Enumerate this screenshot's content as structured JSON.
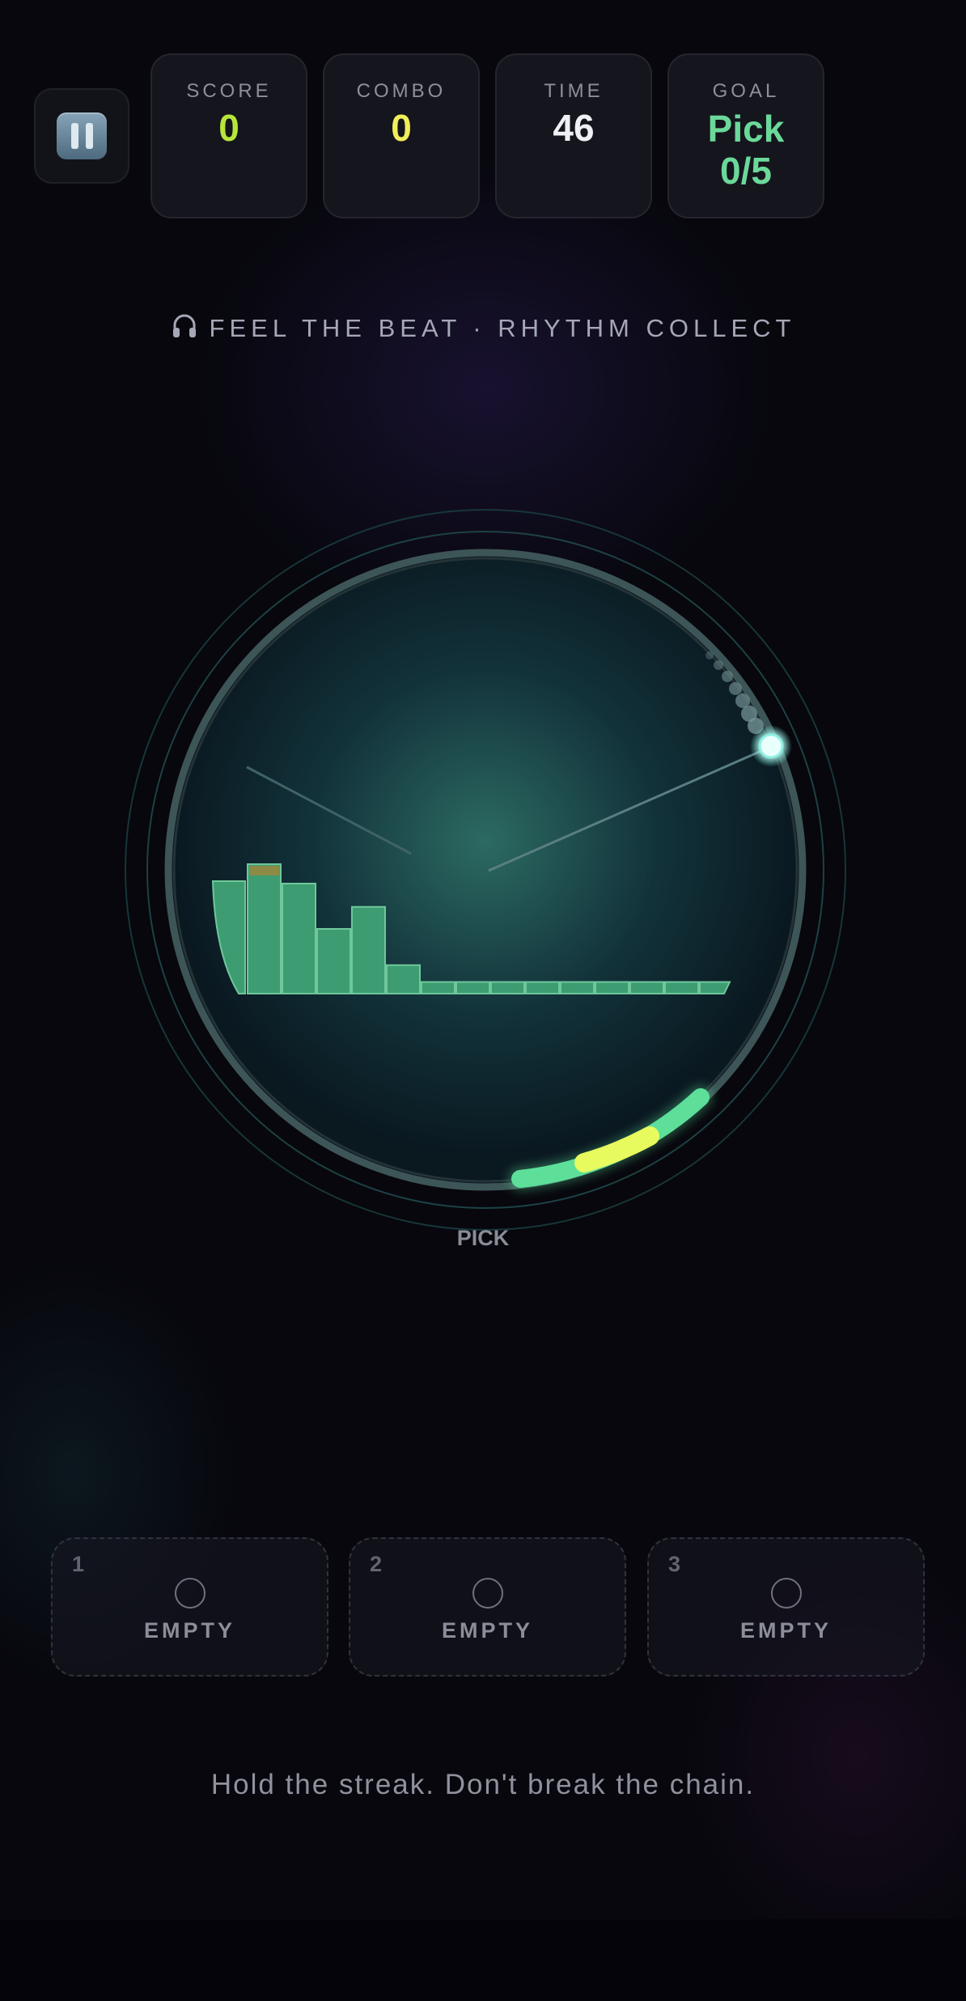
{
  "hud": {
    "pause_icon": "pause-icon",
    "stats": [
      {
        "label": "SCORE",
        "value": "0",
        "color": "#b6e63a"
      },
      {
        "label": "COMBO",
        "value": "0",
        "color": "#f1ee5a"
      },
      {
        "label": "TIME",
        "value": "46",
        "color": "#eef0f6"
      },
      {
        "label": "GOAL",
        "value": "Pick",
        "value2": "0/5",
        "color": "#6bd89a"
      }
    ]
  },
  "subtitle": {
    "icon": "headphones-icon",
    "text": "FEEL THE BEAT · RHYTHM COLLECT"
  },
  "arena": {
    "label": "PICK",
    "accent": "#5ddf9a",
    "highlight": "#e8fb5e",
    "bar_color": "#3d9c72",
    "spectrum_levels": [
      0.85,
      1.0,
      0.85,
      0.5,
      0.67,
      0.22,
      0.09,
      0.09,
      0.09,
      0.09,
      0.09,
      0.09,
      0.09,
      0.09,
      0.09
    ]
  },
  "slots": [
    {
      "number": "1",
      "text": "EMPTY"
    },
    {
      "number": "2",
      "text": "EMPTY"
    },
    {
      "number": "3",
      "text": "EMPTY"
    }
  ],
  "footer": "Hold the streak. Don't break the chain."
}
